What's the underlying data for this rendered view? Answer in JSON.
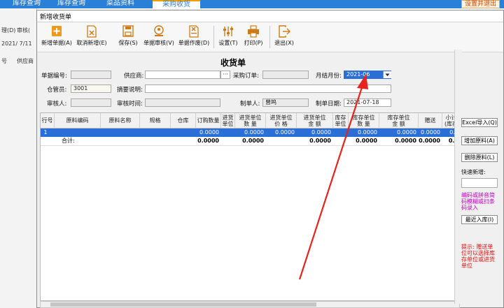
{
  "background_app": {
    "tabs": [
      "库存查询",
      "库存查询",
      "菜品资料",
      "采购收货"
    ],
    "right_button": "设置并退出",
    "left_items": [
      "理(D)",
      "审核(",
      "2021/ 7/11",
      "号",
      "供应商"
    ]
  },
  "dialog": {
    "title": "新增收货单",
    "toolbar": [
      {
        "label": "新增单据(A)",
        "icon": "plus-icon"
      },
      {
        "label": "取消新增(E)",
        "icon": "cancel-doc-icon"
      },
      {
        "label": "保存(S)",
        "icon": "save-icon"
      },
      {
        "label": "单据审核(V)",
        "icon": "approve-icon"
      },
      {
        "label": "单据作废(D)",
        "icon": "void-doc-icon"
      },
      {
        "label": "设置(T)",
        "icon": "settings-sliders-icon"
      },
      {
        "label": "打印(P)",
        "icon": "printer-icon"
      },
      {
        "label": "退出(X)",
        "icon": "exit-icon"
      }
    ],
    "form_title": "收货单",
    "form": {
      "doc_no_label": "单据编号:",
      "doc_no_value": "",
      "supplier_label": "供应商:",
      "supplier_value": "",
      "supplier_button": "···",
      "po_label": "采购订单:",
      "po_value": "",
      "period_label": "月结月份:",
      "period_value": "2021-06",
      "keeper_label": "仓管员:",
      "keeper_value": "3001",
      "memo_label": "摘要说明:",
      "memo_value": "",
      "auditor_label": "审核人:",
      "auditor_value": "",
      "audit_time_label": "审核时间:",
      "audit_time_value": "",
      "maker_label": "制单人:",
      "maker_value": "曾鸣",
      "make_date_label": "制单日期:",
      "make_date_value": "2021-07-18"
    },
    "grid": {
      "columns": [
        "行号",
        "原料编码",
        "原料名称",
        "规格",
        "仓库",
        "订购数量",
        "进货\n单位",
        "进货单位\n数 量",
        "进货单位\n价 格",
        "进货单位\n金 额",
        "库存\n单位",
        "库存单位\n数 量",
        "库存单位\n金 额",
        "赠送",
        "小计\n(库存"
      ],
      "rows": [
        {
          "row_no": "1",
          "order_qty": "0.0000",
          "in_qty": "0.0000",
          "in_price": "0.0000",
          "in_amount": "0.0000",
          "stock_qty": "0.0000",
          "stock_amount": "0.0000",
          "gift": "0.0000",
          "subtotal": "0.0"
        }
      ],
      "total": {
        "label": "合计:",
        "order_qty": "0.0000",
        "in_qty": "0.0000",
        "in_amount": "0.0000",
        "stock_qty": "0.0000",
        "stock_amount": "0.0000",
        "gift": "0.0000",
        "subtotal": "0.0"
      }
    },
    "side": {
      "excel_import": "Excel导入(Q)",
      "add_material": "增加原料(A)",
      "delete_material": "删除原料(L)",
      "quick_add_label": "快速新增:",
      "quick_add_value": "",
      "quick_add_hint": "编码或拼音简码模糊或扫条码录入",
      "recent_in": "最近入库(I)",
      "tip": "提示: 赠送单位可以选择库存单位或进货单位"
    }
  },
  "colors": {
    "accent": "#2a7fd6",
    "selection": "#2b6fd6",
    "arrow": "#e8221c",
    "tip": "#e01010",
    "hint": "#c000c0"
  }
}
